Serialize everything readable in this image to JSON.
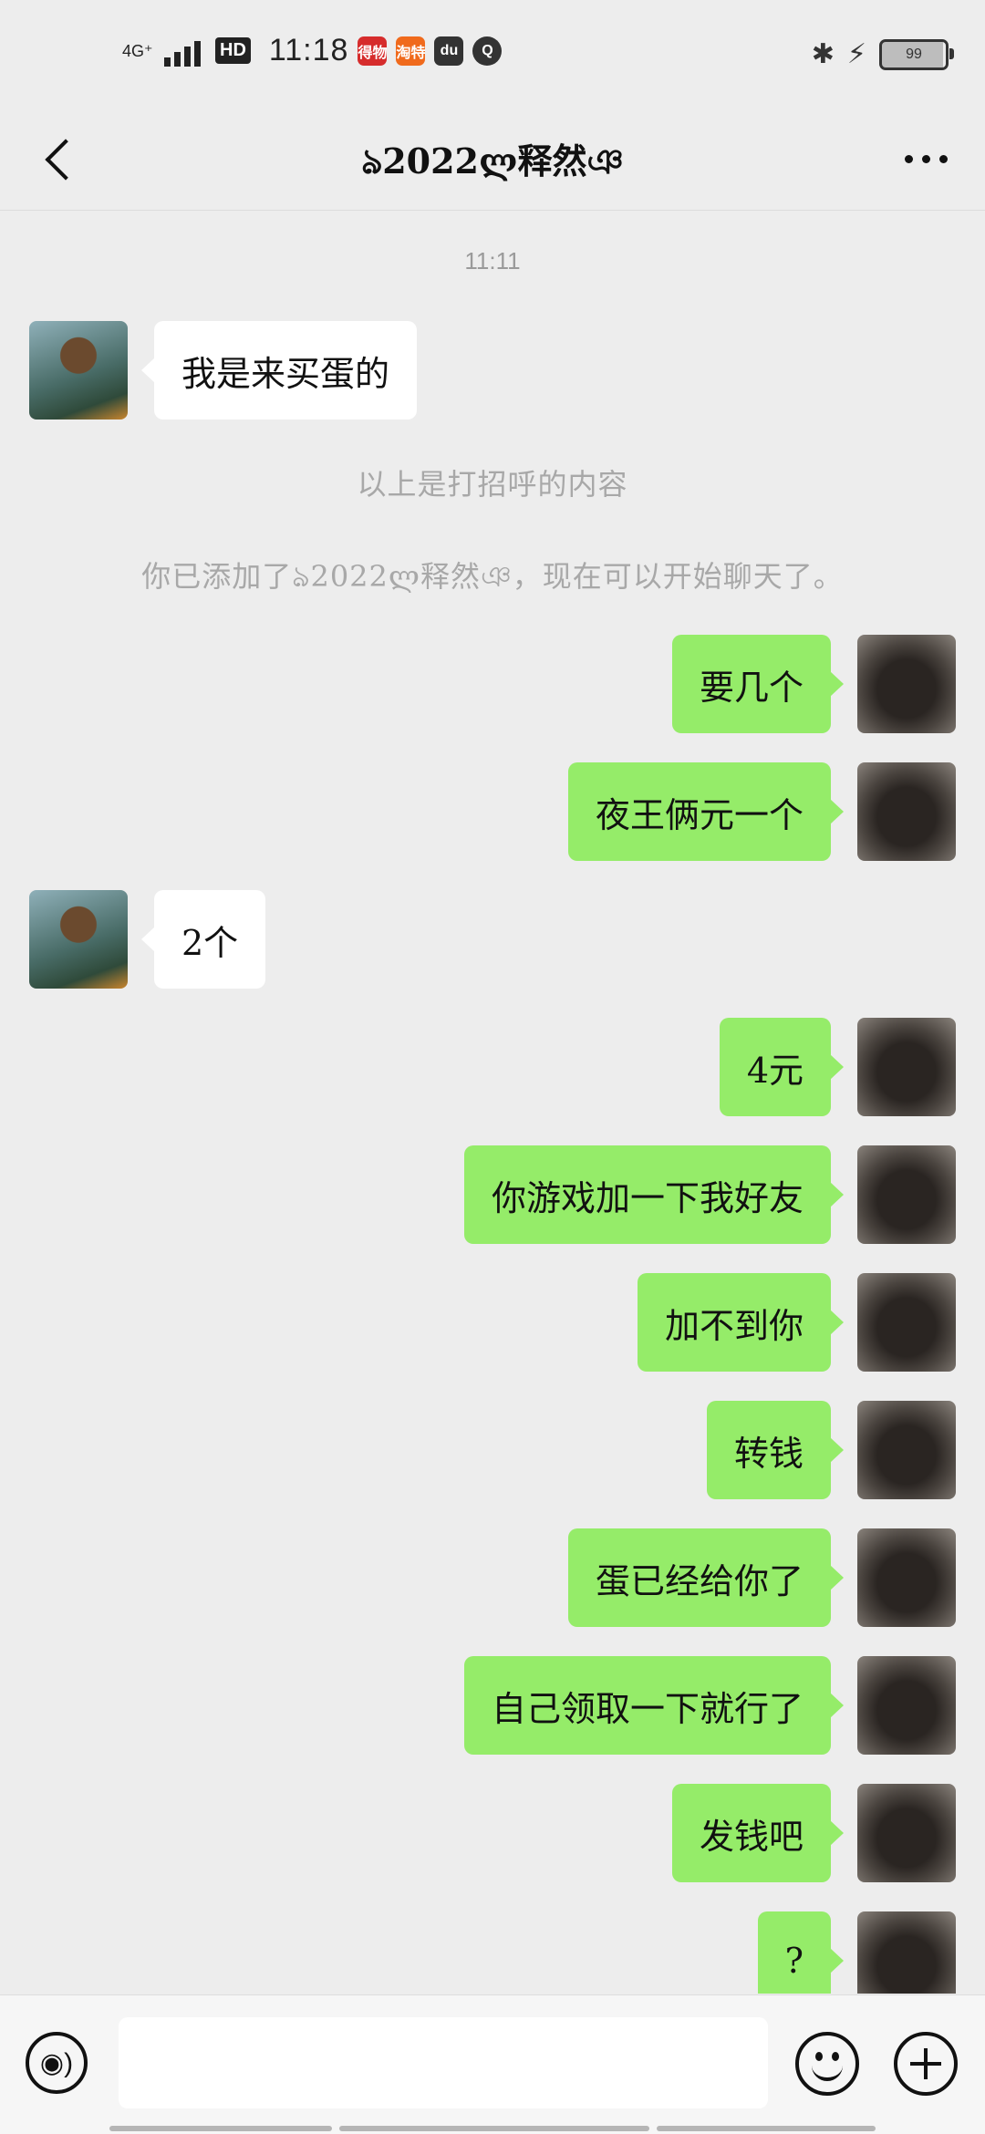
{
  "status_bar": {
    "network": "4G⁺",
    "hd": "HD",
    "time": "11:18",
    "apps": [
      "得物",
      "淘特",
      "du",
      "Q"
    ],
    "battery": "99",
    "icons": [
      "bluetooth-icon",
      "charging-icon"
    ]
  },
  "nav": {
    "title": "ঌ2022ლ释然ঞ",
    "back_icon": "chevron-left-icon",
    "more_icon": "more-dots-icon"
  },
  "chat": {
    "timestamp": "11:11",
    "system_messages": [
      "以上是打招呼的内容",
      "你已添加了ঌ2022ლ释然ঞ，现在可以开始聊天了。"
    ],
    "messages": [
      {
        "side": "left",
        "text": "我是来买蛋的"
      },
      {
        "side": "right",
        "text": "要几个"
      },
      {
        "side": "right",
        "text": "夜王俩元一个"
      },
      {
        "side": "left",
        "text": "2个"
      },
      {
        "side": "right",
        "text": "4元"
      },
      {
        "side": "right",
        "text": "你游戏加一下我好友"
      },
      {
        "side": "right",
        "text": "加不到你"
      },
      {
        "side": "right",
        "text": "转钱"
      },
      {
        "side": "right",
        "text": "蛋已经给你了"
      },
      {
        "side": "right",
        "text": "自己领取一下就行了"
      },
      {
        "side": "right",
        "text": "发钱吧"
      },
      {
        "side": "right",
        "text": "?"
      }
    ]
  },
  "input_bar": {
    "text_value": "",
    "voice_icon": "voice-icon",
    "emoji_icon": "emoji-icon",
    "plus_icon": "plus-icon"
  },
  "colors": {
    "background": "#ededed",
    "bubble_self": "#95ec69",
    "bubble_other": "#ffffff"
  }
}
